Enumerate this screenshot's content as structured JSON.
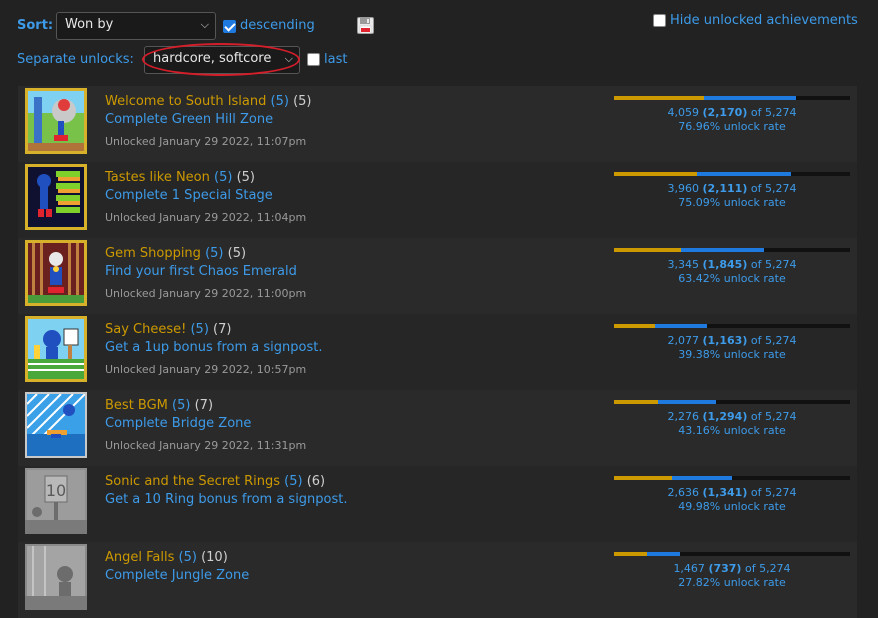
{
  "controls": {
    "sort_label": "Sort:",
    "sort_value": "Won by",
    "descending_label": "descending",
    "descending_checked": true,
    "hide_label": "Hide unlocked achievements",
    "hide_checked": false,
    "separate_label": "Separate unlocks:",
    "separate_value": "hardcore, softcore",
    "last_label": "last",
    "last_checked": false
  },
  "achievements": [
    {
      "title": "Welcome to South Island",
      "points": "(5)",
      "retro": "(5)",
      "desc": "Complete Green Hill Zone",
      "date": "Unlocked January 29 2022, 11:07pm",
      "hc_fraction": 0.3811,
      "sc_fraction": 0.3885,
      "stat_total": "4,059",
      "stat_hc": "(2,170)",
      "stat_of": "of 5,274",
      "rate": "76.96% unlock rate",
      "unlocked": true
    },
    {
      "title": "Tastes like Neon",
      "points": "(5)",
      "retro": "(5)",
      "desc": "Complete 1 Special Stage",
      "date": "Unlocked January 29 2022, 11:04pm",
      "hc_fraction": 0.3506,
      "sc_fraction": 0.4003,
      "stat_total": "3,960",
      "stat_hc": "(2,111)",
      "stat_of": "of 5,274",
      "rate": "75.09% unlock rate",
      "unlocked": true
    },
    {
      "title": "Gem Shopping",
      "points": "(5)",
      "retro": "(5)",
      "desc": "Find your first Chaos Emerald",
      "date": "Unlocked January 29 2022, 11:00pm",
      "hc_fraction": 0.2844,
      "sc_fraction": 0.3498,
      "stat_total": "3,345",
      "stat_hc": "(1,845)",
      "stat_of": "of 5,274",
      "rate": "63.42% unlock rate",
      "unlocked": true
    },
    {
      "title": "Say Cheese!",
      "points": "(5)",
      "retro": "(7)",
      "desc": "Get a 1up bonus from a signpost.",
      "date": "Unlocked January 29 2022, 10:57pm",
      "hc_fraction": 0.1733,
      "sc_fraction": 0.2205,
      "stat_total": "2,077",
      "stat_hc": "(1,163)",
      "stat_of": "of 5,274",
      "rate": "39.38% unlock rate",
      "unlocked": true
    },
    {
      "title": "Best BGM",
      "points": "(5)",
      "retro": "(7)",
      "desc": "Complete Bridge Zone",
      "date": "Unlocked January 29 2022, 11:31pm",
      "hc_fraction": 0.1862,
      "sc_fraction": 0.2454,
      "stat_total": "2,276",
      "stat_hc": "(1,294)",
      "stat_of": "of 5,274",
      "rate": "43.16% unlock rate",
      "unlocked": true
    },
    {
      "title": "Sonic and the Secret Rings",
      "points": "(5)",
      "retro": "(6)",
      "desc": "Get a 10 Ring bonus from a signpost.",
      "date": "",
      "hc_fraction": 0.2455,
      "sc_fraction": 0.2543,
      "stat_total": "2,636",
      "stat_hc": "(1,341)",
      "stat_of": "of 5,274",
      "rate": "49.98% unlock rate",
      "unlocked": false
    },
    {
      "title": "Angel Falls",
      "points": "(5)",
      "retro": "(10)",
      "desc": "Complete Jungle Zone",
      "date": "",
      "hc_fraction": 0.1384,
      "sc_fraction": 0.1397,
      "stat_total": "1,467",
      "stat_hc": "(737)",
      "stat_of": "of 5,274",
      "rate": "27.82% unlock rate",
      "unlocked": false
    }
  ],
  "colors": {
    "accent": "#3d9be9",
    "gold": "#cc9900",
    "hardcore_bar": "#cc9900",
    "softcore_bar": "#1f7ae0",
    "badge_frame": "#d8b12b",
    "highlight_ring": "#d41e2a"
  },
  "icons": {
    "save": "floppy-disk-icon"
  }
}
